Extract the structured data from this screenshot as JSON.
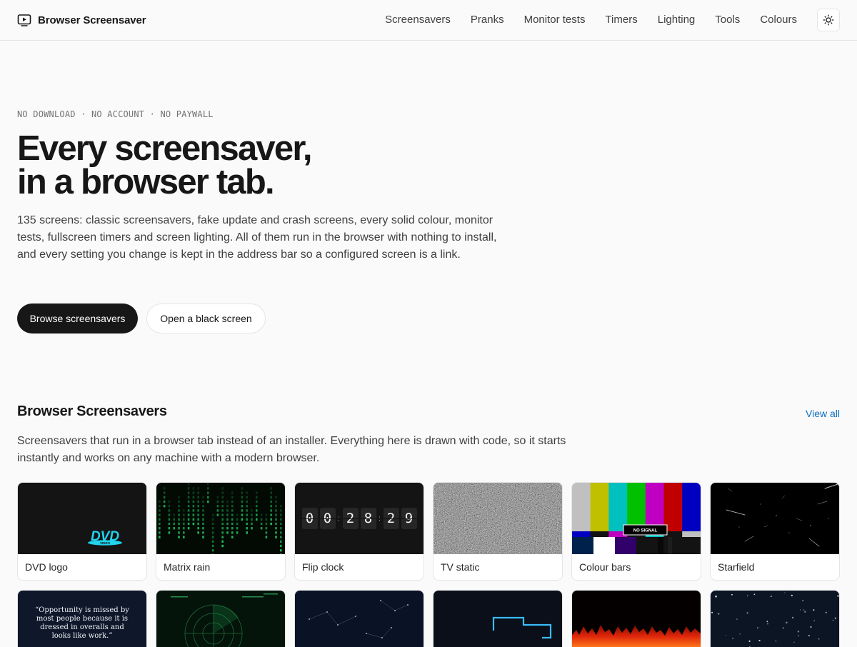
{
  "brand": {
    "name": "Browser Screensaver",
    "icon": "tv-play-icon"
  },
  "nav": [
    {
      "label": "Screensavers"
    },
    {
      "label": "Pranks"
    },
    {
      "label": "Monitor tests"
    },
    {
      "label": "Timers"
    },
    {
      "label": "Lighting"
    },
    {
      "label": "Tools"
    },
    {
      "label": "Colours"
    }
  ],
  "theme_toggle": {
    "icon": "sun-icon"
  },
  "hero": {
    "eyebrow": "NO DOWNLOAD · NO ACCOUNT · NO PAYWALL",
    "title_line1": "Every screensaver,",
    "title_line2": "in a browser tab.",
    "description": "135 screens: classic screensavers, fake update and crash screens, every solid colour, monitor tests, fullscreen timers and screen lighting. All of them run in the browser with nothing to install, and every setting you change is kept in the address bar so a configured screen is a link.",
    "primary_button": "Browse screensavers",
    "secondary_button": "Open a black screen"
  },
  "section": {
    "title": "Browser Screensavers",
    "view_all": "View all",
    "description": "Screensavers that run in a browser tab instead of an installer. Everything here is drawn with code, so it starts instantly and works on any machine with a modern browser."
  },
  "cards": [
    {
      "label": "DVD logo",
      "logo_text": "DVD",
      "logo_sub": "VIDEO",
      "logo_color": "#22d3ee"
    },
    {
      "label": "Matrix rain",
      "rain_color": "#22c55e"
    },
    {
      "label": "Flip clock",
      "digits": [
        "0",
        "0",
        "2",
        "8",
        "2",
        "9"
      ]
    },
    {
      "label": "TV static"
    },
    {
      "label": "Colour bars",
      "badge": "NO SIGNAL"
    },
    {
      "label": "Starfield"
    }
  ],
  "cards_row2": [
    {
      "name": "quote",
      "quote": "“Opportunity is missed by most people because it is dressed in overalls and looks like work.”"
    },
    {
      "name": "radar"
    },
    {
      "name": "constellations"
    },
    {
      "name": "pipes"
    },
    {
      "name": "fire"
    },
    {
      "name": "snow"
    }
  ]
}
